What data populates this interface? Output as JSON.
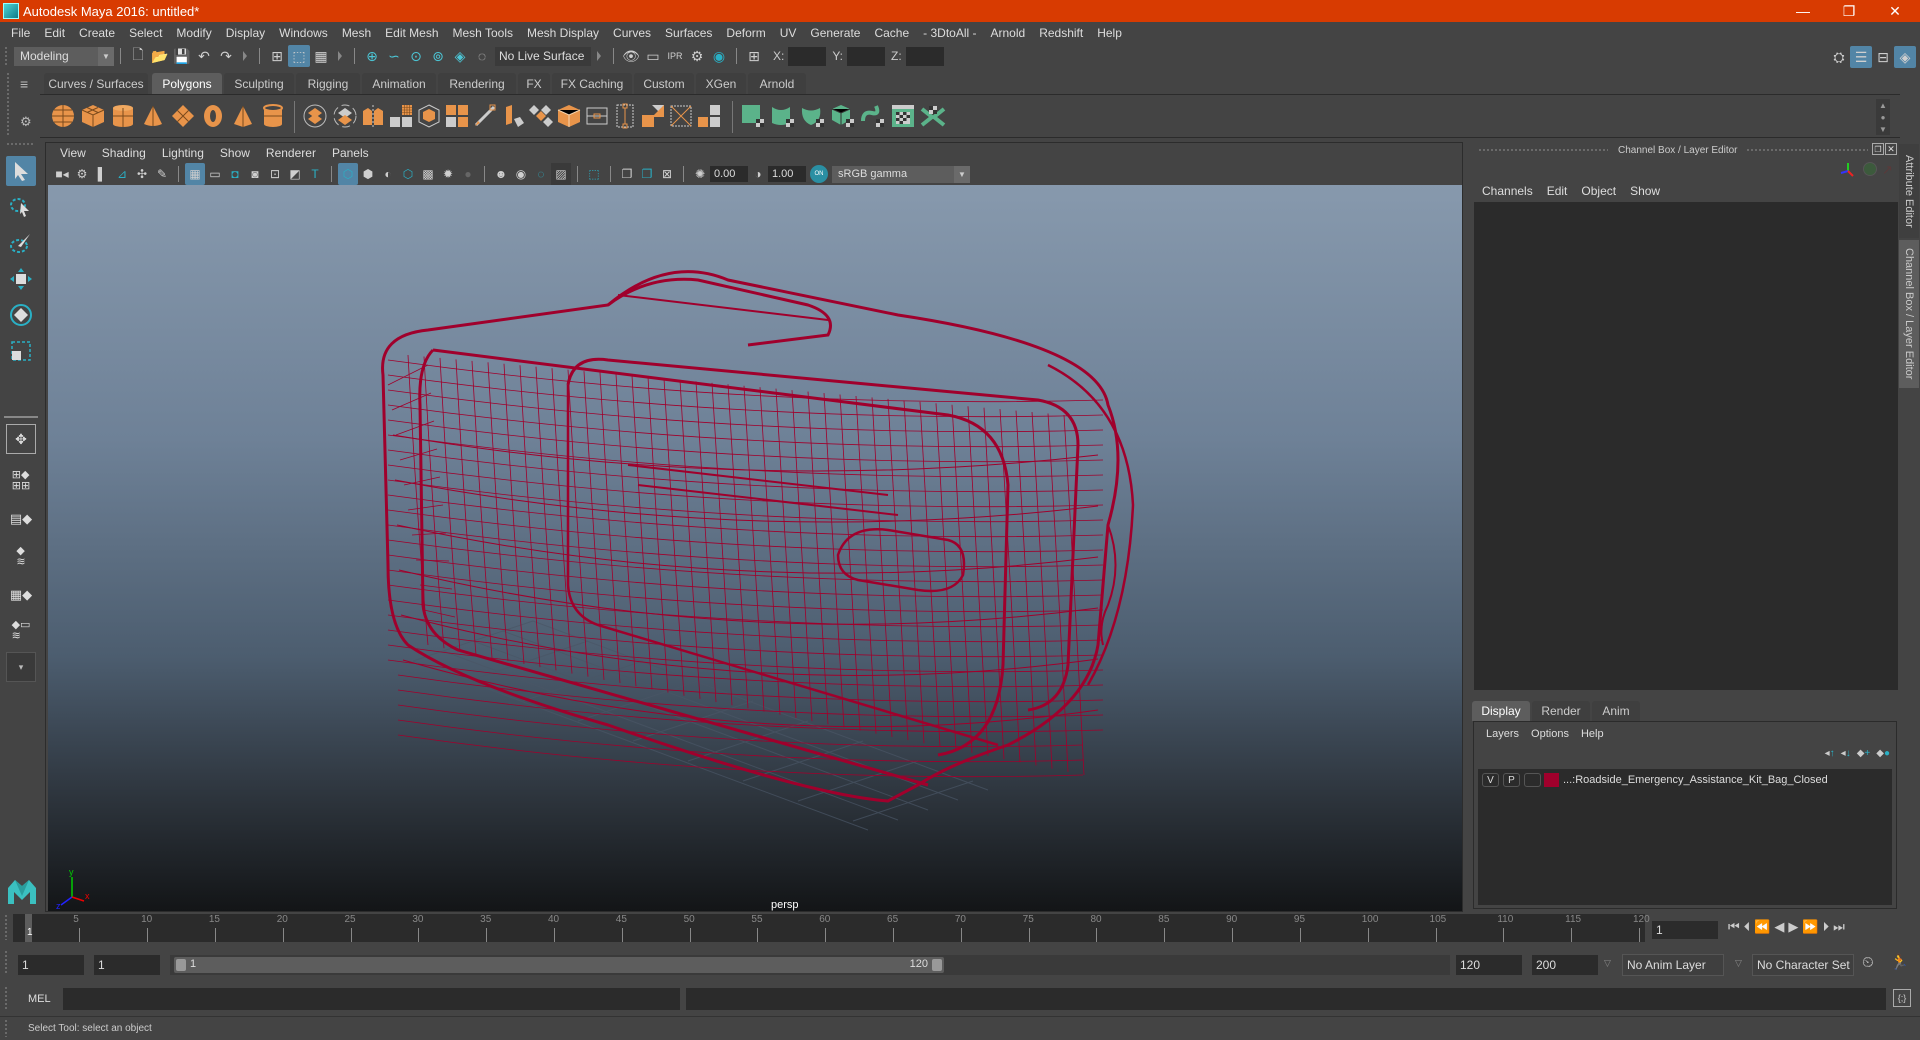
{
  "window": {
    "title": "Autodesk Maya 2016: untitled*",
    "controls": {
      "minimize": "—",
      "restore": "❐",
      "close": "✕"
    }
  },
  "menubar": [
    "File",
    "Edit",
    "Create",
    "Select",
    "Modify",
    "Display",
    "Windows",
    "Mesh",
    "Edit Mesh",
    "Mesh Tools",
    "Mesh Display",
    "Curves",
    "Surfaces",
    "Deform",
    "UV",
    "Generate",
    "Cache",
    "- 3DtoAll -",
    "Arnold",
    "Redshift",
    "Help"
  ],
  "statusline": {
    "menuset": "Modeling",
    "live_surface": "No Live Surface",
    "x_label": "X:",
    "y_label": "Y:",
    "z_label": "Z:",
    "x_value": "",
    "y_value": "",
    "z_value": ""
  },
  "shelf": {
    "tabs": [
      "Curves / Surfaces",
      "Polygons",
      "Sculpting",
      "Rigging",
      "Animation",
      "Rendering",
      "FX",
      "FX Caching",
      "Custom",
      "XGen",
      "Arnold"
    ],
    "active_tab": "Polygons",
    "icons": [
      "poly-sphere-icon",
      "poly-cube-icon",
      "poly-cylinder-icon",
      "poly-cone-icon",
      "poly-plane-icon",
      "poly-torus-icon",
      "poly-pyramid-icon",
      "poly-pipe-icon",
      "combine-icon",
      "separate-icon",
      "mirror-icon",
      "smooth-icon",
      "bevel-icon",
      "extrude-icon",
      "multicut-icon",
      "target-weld-icon",
      "bridge-icon",
      "merge-vertex-icon",
      "fill-hole-icon",
      "insert-edge-loop-icon",
      "edge-loop-icon",
      "polygon-to-uv-icon",
      "uv-layout-icon",
      "planar-uv-icon",
      "cylindrical-uv-icon",
      "spherical-uv-icon",
      "automatic-uv-icon",
      "unfold-uv-icon",
      "uv-editor-icon",
      "sew-uv-icon"
    ]
  },
  "viewport": {
    "menus": [
      "View",
      "Shading",
      "Lighting",
      "Show",
      "Renderer",
      "Panels"
    ],
    "exposure": "0.00",
    "gamma": "1.00",
    "color_space": "sRGB gamma",
    "camera_label": "persp",
    "wire_color": "#a0002c"
  },
  "channel_box": {
    "title": "Channel Box / Layer Editor",
    "menus": [
      "Channels",
      "Edit",
      "Object",
      "Show"
    ]
  },
  "layer_editor": {
    "tabs": [
      "Display",
      "Render",
      "Anim"
    ],
    "active_tab": "Display",
    "menus": [
      "Layers",
      "Options",
      "Help"
    ],
    "layers": [
      {
        "visible": "V",
        "playback": "P",
        "color": "#a0002c",
        "name": "...:Roadside_Emergency_Assistance_Kit_Bag_Closed"
      }
    ]
  },
  "side_tabs": [
    "Attribute Editor",
    "Channel Box / Layer Editor"
  ],
  "timeline": {
    "ticks": [
      "5",
      "10",
      "15",
      "20",
      "25",
      "30",
      "35",
      "40",
      "45",
      "50",
      "55",
      "60",
      "65",
      "70",
      "75",
      "80",
      "85",
      "90",
      "95",
      "100",
      "105",
      "110",
      "115",
      "120"
    ],
    "current_frame_marker": "1",
    "current_frame": "1"
  },
  "range": {
    "start": "1",
    "playback_start": "1",
    "slider_start": "1",
    "slider_end": "120",
    "playback_end": "120",
    "end": "200",
    "anim_layer": "No Anim Layer",
    "character_set": "No Character Set"
  },
  "command_line": {
    "label": "MEL",
    "value": "",
    "result": ""
  },
  "help_line": "Select Tool: select an object"
}
